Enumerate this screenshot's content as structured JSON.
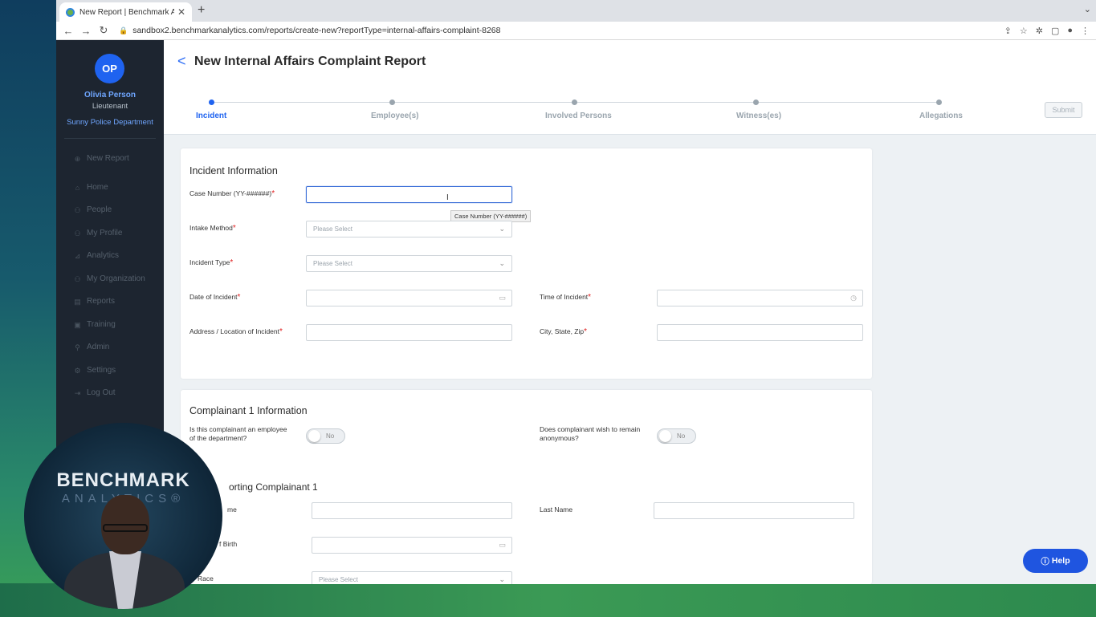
{
  "browser": {
    "tab_title": "New Report | Benchmark Analy",
    "url": "sandbox2.benchmarkanalytics.com/reports/create-new?reportType=internal-affairs-complaint-8268"
  },
  "user": {
    "initials": "OP",
    "name": "Olivia Person",
    "rank": "Lieutenant",
    "department": "Sunny Police Department"
  },
  "sidebar": {
    "items": [
      {
        "label": "New Report",
        "icon": "plus-circle-icon"
      },
      {
        "label": "Home",
        "icon": "home-icon"
      },
      {
        "label": "People",
        "icon": "people-icon"
      },
      {
        "label": "My Profile",
        "icon": "profile-icon"
      },
      {
        "label": "Analytics",
        "icon": "analytics-icon"
      },
      {
        "label": "My Organization",
        "icon": "organization-icon"
      },
      {
        "label": "Reports",
        "icon": "reports-icon"
      },
      {
        "label": "Training",
        "icon": "training-icon"
      },
      {
        "label": "Admin",
        "icon": "admin-icon"
      },
      {
        "label": "Settings",
        "icon": "gear-icon"
      },
      {
        "label": "Log Out",
        "icon": "logout-icon"
      }
    ]
  },
  "header": {
    "title": "New Internal Affairs Complaint Report",
    "submit_label": "Submit",
    "steps": [
      "Incident",
      "Employee(s)",
      "Involved Persons",
      "Witness(es)",
      "Allegations"
    ],
    "active_step": "Incident"
  },
  "incident": {
    "title": "Incident Information",
    "case_number_label": "Case Number (YY-######)",
    "case_number_value": "",
    "case_number_tooltip": "Case Number (YY-######)",
    "intake_method_label": "Intake Method",
    "intake_method_placeholder": "Please Select",
    "incident_type_label": "Incident Type",
    "incident_type_placeholder": "Please Select",
    "date_label": "Date of Incident",
    "time_label": "Time of Incident",
    "address_label": "Address / Location of Incident",
    "city_label": "City, State, Zip"
  },
  "complainant": {
    "title": "Complainant 1 Information",
    "employee_question": "Is this complainant an employee of the department?",
    "employee_toggle": "No",
    "anonymous_question": "Does complainant wish to remain anonymous?",
    "anonymous_toggle": "No",
    "reporting_title": "orting Complainant 1",
    "first_name_label": "me",
    "last_name_label": "Last Name",
    "dob_label": "f Birth",
    "race_label": "Race",
    "race_placeholder": "Please Select"
  },
  "help_label": "Help",
  "webcam": {
    "watermark_top": "BENCHMARK",
    "watermark_bottom": "ANALYTICS®"
  }
}
